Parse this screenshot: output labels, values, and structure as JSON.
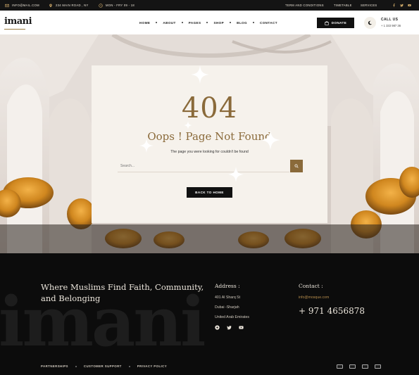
{
  "topbar": {
    "email": "INFO@MAIL.COM",
    "address": "234 MAIN ROAD , NY",
    "hours": "MON - FRY 09 - 18",
    "links": [
      "TERM AND CONDITIONS",
      "TIMETABLE",
      "SERVICES"
    ],
    "social_icons": [
      "facebook-icon",
      "twitter-icon",
      "youtube-icon"
    ]
  },
  "header": {
    "logo": "imani",
    "nav": [
      "HOME",
      "ABOUT",
      "PAGES",
      "SHOP",
      "BLOG",
      "CONTACT"
    ],
    "donate_label": "DONATE",
    "call_label": "CALL US",
    "call_number": "+ 1 333 987 36"
  },
  "card": {
    "code": "404",
    "title": "Oops ! Page Not Found",
    "subtitle": "The page you were looking for couldn't be found",
    "search_placeholder": "Search...",
    "back_label": "BACK TO HOME"
  },
  "footer": {
    "tagline": "Where Muslims Find Faith, Community, and Belonging",
    "watermark": "imani",
    "address_title": "Address :",
    "address_lines": [
      "401 Al Sharq St",
      "Dubai -Sharjah",
      "United Arab Emirates"
    ],
    "contact_title": "Contact :",
    "email": "info@mosque.com",
    "phone": "+ 971 4656878",
    "bottom_links": [
      "PARTNERSHIPS",
      "CUSTOMER SUPPORT",
      "PRIVACY POLICY"
    ],
    "payment_icons": [
      "card-icon-1",
      "card-icon-2",
      "card-icon-3",
      "card-icon-4"
    ]
  },
  "colors": {
    "accent": "#8a6a3a",
    "dark": "#111111",
    "card_bg": "#f6f2ec"
  }
}
